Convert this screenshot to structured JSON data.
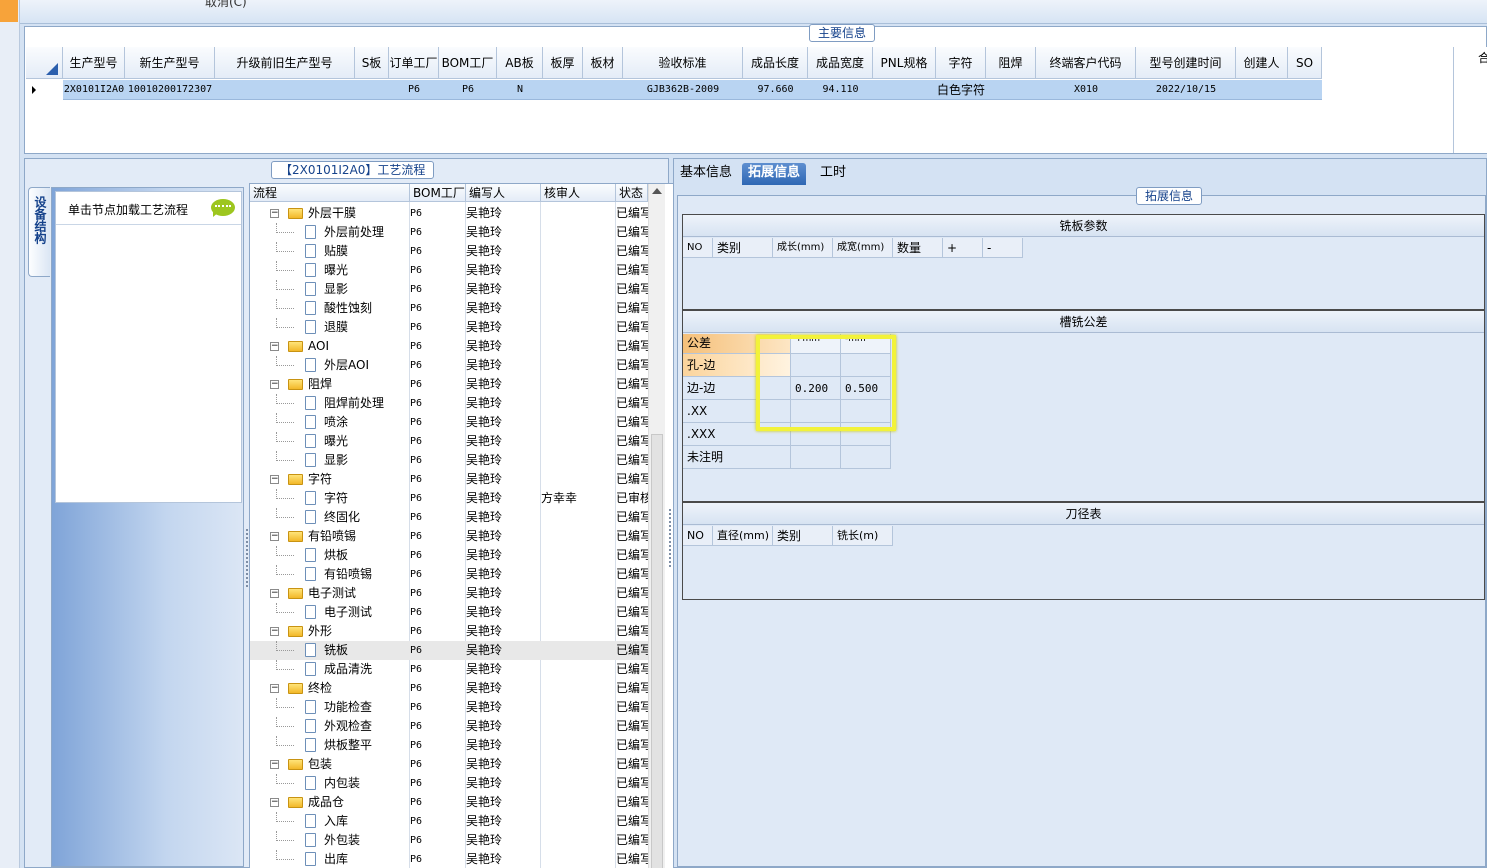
{
  "toolbar": {
    "cancel_label": "取消(C)"
  },
  "main_info": {
    "title": "主要信息",
    "columns": [
      "生产型号",
      "新生产型号",
      "升级前旧生产型号",
      "S板",
      "订单工厂",
      "BOM工厂",
      "AB板",
      "板厚",
      "板材",
      "验收标准",
      "成品长度",
      "成品宽度",
      "PNL规格",
      "字符",
      "阻焊",
      "终端客户代码",
      "型号创建时间",
      "创建人",
      "SO"
    ],
    "row": [
      "2X0101I2A0",
      "10010200172307",
      "",
      "",
      "P6",
      "P6",
      "N",
      "",
      "",
      "GJB362B-2009",
      "97.660",
      "94.110",
      "",
      "白色字符",
      "",
      "X010",
      "2022/10/15",
      "",
      ""
    ],
    "right_header": "合"
  },
  "side": {
    "tab_label": "设备结构",
    "hint": "单击节点加载工艺流程"
  },
  "process_flow": {
    "title": "【2X0101I2A0】工艺流程",
    "columns": [
      "流程",
      "BOM工厂",
      "编写人",
      "核审人",
      "状态"
    ],
    "rows": [
      {
        "name": "外层干膜",
        "level": 1,
        "bom": "P6",
        "writer": "吴艳玲",
        "reviewer": "",
        "status": "已编写"
      },
      {
        "name": "外层前处理",
        "level": 2,
        "bom": "P6",
        "writer": "吴艳玲",
        "reviewer": "",
        "status": "已编写"
      },
      {
        "name": "贴膜",
        "level": 2,
        "bom": "P6",
        "writer": "吴艳玲",
        "reviewer": "",
        "status": "已编写"
      },
      {
        "name": "曝光",
        "level": 2,
        "bom": "P6",
        "writer": "吴艳玲",
        "reviewer": "",
        "status": "已编写"
      },
      {
        "name": "显影",
        "level": 2,
        "bom": "P6",
        "writer": "吴艳玲",
        "reviewer": "",
        "status": "已编写"
      },
      {
        "name": "酸性蚀刻",
        "level": 2,
        "bom": "P6",
        "writer": "吴艳玲",
        "reviewer": "",
        "status": "已编写"
      },
      {
        "name": "退膜",
        "level": 2,
        "bom": "P6",
        "writer": "吴艳玲",
        "reviewer": "",
        "status": "已编写"
      },
      {
        "name": "AOI",
        "level": 1,
        "bom": "P6",
        "writer": "吴艳玲",
        "reviewer": "",
        "status": "已编写"
      },
      {
        "name": "外层AOI",
        "level": 2,
        "bom": "P6",
        "writer": "吴艳玲",
        "reviewer": "",
        "status": "已编写"
      },
      {
        "name": "阻焊",
        "level": 1,
        "bom": "P6",
        "writer": "吴艳玲",
        "reviewer": "",
        "status": "已编写"
      },
      {
        "name": "阻焊前处理",
        "level": 2,
        "bom": "P6",
        "writer": "吴艳玲",
        "reviewer": "",
        "status": "已编写"
      },
      {
        "name": "喷涂",
        "level": 2,
        "bom": "P6",
        "writer": "吴艳玲",
        "reviewer": "",
        "status": "已编写"
      },
      {
        "name": "曝光",
        "level": 2,
        "bom": "P6",
        "writer": "吴艳玲",
        "reviewer": "",
        "status": "已编写"
      },
      {
        "name": "显影",
        "level": 2,
        "bom": "P6",
        "writer": "吴艳玲",
        "reviewer": "",
        "status": "已编写"
      },
      {
        "name": "字符",
        "level": 1,
        "bom": "P6",
        "writer": "吴艳玲",
        "reviewer": "",
        "status": "已编写"
      },
      {
        "name": "字符",
        "level": 2,
        "bom": "P6",
        "writer": "吴艳玲",
        "reviewer": "方幸幸",
        "status": "已审核"
      },
      {
        "name": "终固化",
        "level": 2,
        "bom": "P6",
        "writer": "吴艳玲",
        "reviewer": "",
        "status": "已编写"
      },
      {
        "name": "有铅喷锡",
        "level": 1,
        "bom": "P6",
        "writer": "吴艳玲",
        "reviewer": "",
        "status": "已编写"
      },
      {
        "name": "烘板",
        "level": 2,
        "bom": "P6",
        "writer": "吴艳玲",
        "reviewer": "",
        "status": "已编写"
      },
      {
        "name": "有铅喷锡",
        "level": 2,
        "bom": "P6",
        "writer": "吴艳玲",
        "reviewer": "",
        "status": "已编写"
      },
      {
        "name": "电子测试",
        "level": 1,
        "bom": "P6",
        "writer": "吴艳玲",
        "reviewer": "",
        "status": "已编写"
      },
      {
        "name": "电子测试",
        "level": 2,
        "bom": "P6",
        "writer": "吴艳玲",
        "reviewer": "",
        "status": "已编写"
      },
      {
        "name": "外形",
        "level": 1,
        "bom": "P6",
        "writer": "吴艳玲",
        "reviewer": "",
        "status": "已编写"
      },
      {
        "name": "铣板",
        "level": 2,
        "bom": "P6",
        "writer": "吴艳玲",
        "reviewer": "",
        "status": "已编写"
      },
      {
        "name": "成品清洗",
        "level": 2,
        "bom": "P6",
        "writer": "吴艳玲",
        "reviewer": "",
        "status": "已编写"
      },
      {
        "name": "终检",
        "level": 1,
        "bom": "P6",
        "writer": "吴艳玲",
        "reviewer": "",
        "status": "已编写"
      },
      {
        "name": "功能检查",
        "level": 2,
        "bom": "P6",
        "writer": "吴艳玲",
        "reviewer": "",
        "status": "已编写"
      },
      {
        "name": "外观检查",
        "level": 2,
        "bom": "P6",
        "writer": "吴艳玲",
        "reviewer": "",
        "status": "已编写"
      },
      {
        "name": "烘板整平",
        "level": 2,
        "bom": "P6",
        "writer": "吴艳玲",
        "reviewer": "",
        "status": "已编写"
      },
      {
        "name": "包装",
        "level": 1,
        "bom": "P6",
        "writer": "吴艳玲",
        "reviewer": "",
        "status": "已编写"
      },
      {
        "name": "内包装",
        "level": 2,
        "bom": "P6",
        "writer": "吴艳玲",
        "reviewer": "",
        "status": "已编写"
      },
      {
        "name": "成品仓",
        "level": 1,
        "bom": "P6",
        "writer": "吴艳玲",
        "reviewer": "",
        "status": "已编写"
      },
      {
        "name": "入库",
        "level": 2,
        "bom": "P6",
        "writer": "吴艳玲",
        "reviewer": "",
        "status": "已编写"
      },
      {
        "name": "外包装",
        "level": 2,
        "bom": "P6",
        "writer": "吴艳玲",
        "reviewer": "",
        "status": "已编写"
      },
      {
        "name": "出库",
        "level": 2,
        "bom": "P6",
        "writer": "吴艳玲",
        "reviewer": "",
        "status": "已编写"
      }
    ],
    "selected_row": "铣板"
  },
  "tabs": [
    {
      "label": "基本信息",
      "active": false
    },
    {
      "label": "拓展信息",
      "active": true
    },
    {
      "label": "工时",
      "active": false
    }
  ],
  "ext": {
    "title": "拓展信息",
    "mill_params": {
      "title": "铣板参数",
      "columns": [
        "NO",
        "类别",
        "成长(mm)",
        "成宽(mm)",
        "数量",
        "+",
        "-"
      ]
    },
    "tolerance": {
      "title": "槽铣公差",
      "header": [
        "公差",
        "+mm",
        "-mm"
      ],
      "rows": [
        {
          "label": "孔-边",
          "plus": "",
          "minus": ""
        },
        {
          "label": "边-边",
          "plus": "0.200",
          "minus": "0.500"
        },
        {
          "label": ".XX",
          "plus": "",
          "minus": ""
        },
        {
          "label": ".XXX",
          "plus": "",
          "minus": ""
        },
        {
          "label": "未注明",
          "plus": "",
          "minus": ""
        }
      ]
    },
    "cutter": {
      "title": "刀径表",
      "columns": [
        "NO",
        "直径(mm)",
        "类别",
        "铣长(m)"
      ]
    }
  },
  "colors": {
    "selected_row": "#b9d4f2",
    "active_tab": "#2e67b4",
    "highlight": "#f2f23a",
    "tolerance_header": "#f5c07a"
  }
}
